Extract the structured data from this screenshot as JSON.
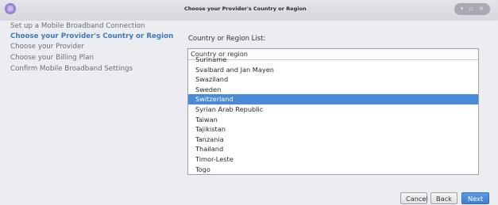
{
  "window": {
    "title": "Choose your Provider's Country or Region",
    "controls": {
      "minimize": "▾",
      "maximize": "▫",
      "close": "✕"
    }
  },
  "sidebar": {
    "items": [
      {
        "label": "Set up a Mobile Broadband Connection",
        "active": false
      },
      {
        "label": "Choose your Provider's Country or Region",
        "active": true
      },
      {
        "label": "Choose your Provider",
        "active": false
      },
      {
        "label": "Choose your Billing Plan",
        "active": false
      },
      {
        "label": "Confirm Mobile Broadband Settings",
        "active": false
      }
    ]
  },
  "main": {
    "list_label": "Country or Region List:",
    "column_header": "Country or region",
    "rows": [
      {
        "label": "Suriname",
        "selected": false
      },
      {
        "label": "Svalbard and Jan Mayen",
        "selected": false
      },
      {
        "label": "Swaziland",
        "selected": false
      },
      {
        "label": "Sweden",
        "selected": false
      },
      {
        "label": "Switzerland",
        "selected": true
      },
      {
        "label": "Syrian Arab Republic",
        "selected": false
      },
      {
        "label": "Taiwan",
        "selected": false
      },
      {
        "label": "Tajikistan",
        "selected": false
      },
      {
        "label": "Tanzania",
        "selected": false
      },
      {
        "label": "Thailand",
        "selected": false
      },
      {
        "label": "Timor-Leste",
        "selected": false
      },
      {
        "label": "Togo",
        "selected": false
      }
    ]
  },
  "buttons": {
    "cancel": "Cancel",
    "back": "Back",
    "next": "Next"
  },
  "colors": {
    "accent": "#3f78c2",
    "selection": "#4a8bd8"
  }
}
